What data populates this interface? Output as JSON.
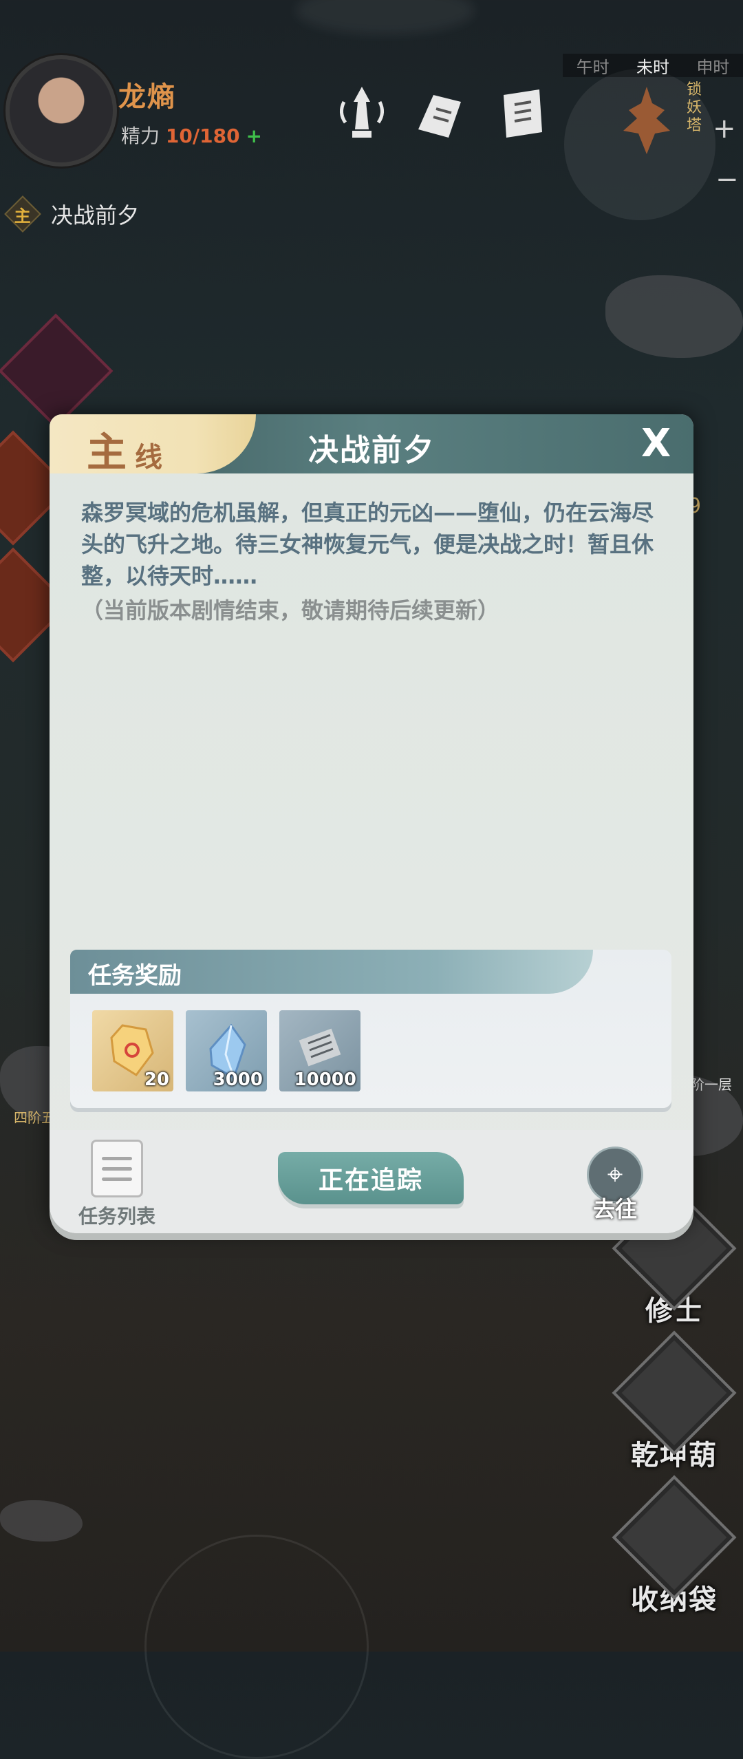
{
  "player": {
    "name": "龙熵",
    "energy_label": "精力",
    "energy_value": "10/180",
    "energy_plus": "+"
  },
  "time_strip": [
    "午时",
    "未时",
    "申时"
  ],
  "map": {
    "tower_label": "锁妖塔",
    "zoom_plus": "+",
    "zoom_minus": "−",
    "floor_label_right": "阶一层",
    "floor_label_left": "四阶五",
    "side_number": "9"
  },
  "quest_tracker": {
    "tag": "主",
    "title": "决战前夕"
  },
  "dialog": {
    "tab_main": "主",
    "tab_line": "线",
    "title": "决战前夕",
    "close": "X",
    "text": "森罗冥域的危机虽解，但真正的元凶——堕仙，仍在云海尽头的飞升之地。待三女神恢复元气，便是决战之时！暂且休整，以待天时……",
    "note": "（当前版本剧情结束，敬请期待后续更新）",
    "reward_header": "任务奖励",
    "rewards": [
      {
        "qty": "20",
        "icon": "gold-talisman-crystal-icon"
      },
      {
        "qty": "3000",
        "icon": "blue-crystal-icon"
      },
      {
        "qty": "10000",
        "icon": "scroll-icon"
      }
    ],
    "list_label": "任务列表",
    "track_label": "正在追踪",
    "go_label": "去往"
  },
  "side_buttons": [
    {
      "label": "修士",
      "icon": "cultivator-icon"
    },
    {
      "label": "乾坤葫",
      "icon": "gourd-icon"
    },
    {
      "label": "收纳袋",
      "icon": "bag-icon"
    }
  ]
}
